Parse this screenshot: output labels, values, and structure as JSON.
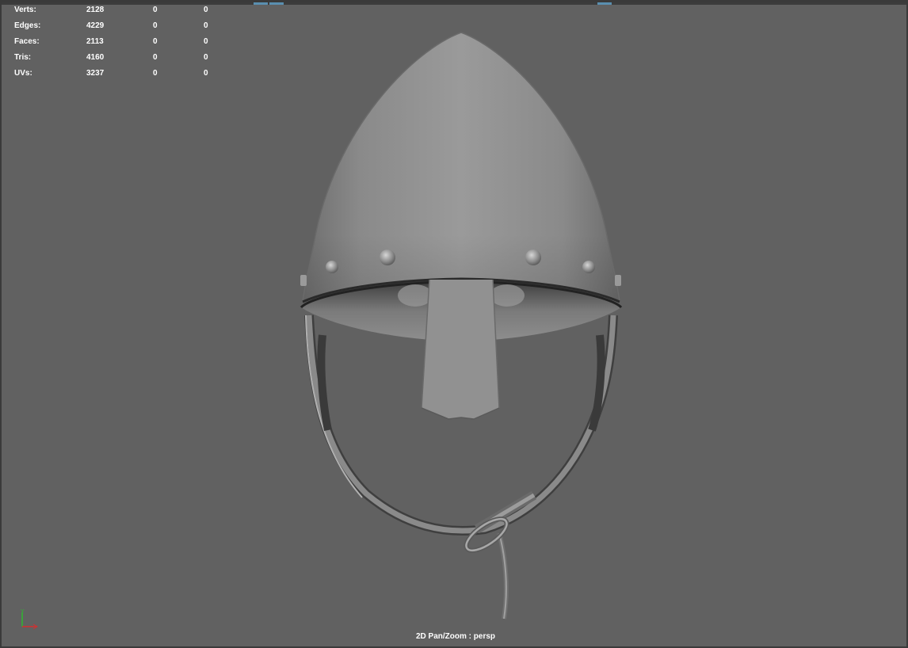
{
  "hud": {
    "rows": [
      {
        "label": "Verts:",
        "v1": "2128",
        "v2": "0",
        "v3": "0"
      },
      {
        "label": "Edges:",
        "v1": "4229",
        "v2": "0",
        "v3": "0"
      },
      {
        "label": "Faces:",
        "v1": "2113",
        "v2": "0",
        "v3": "0"
      },
      {
        "label": "Tris:",
        "v1": "4160",
        "v2": "0",
        "v3": "0"
      },
      {
        "label": "UVs:",
        "v1": "3237",
        "v2": "0",
        "v3": "0"
      }
    ]
  },
  "viewport": {
    "camera_label": "2D Pan/Zoom : persp",
    "background_color": "#616161",
    "model": "nasal-helmet-with-chinstrap"
  },
  "axis_gizmo": {
    "y_label": "Y",
    "y_color": "#2fb82f",
    "x_color": "#d23030"
  }
}
